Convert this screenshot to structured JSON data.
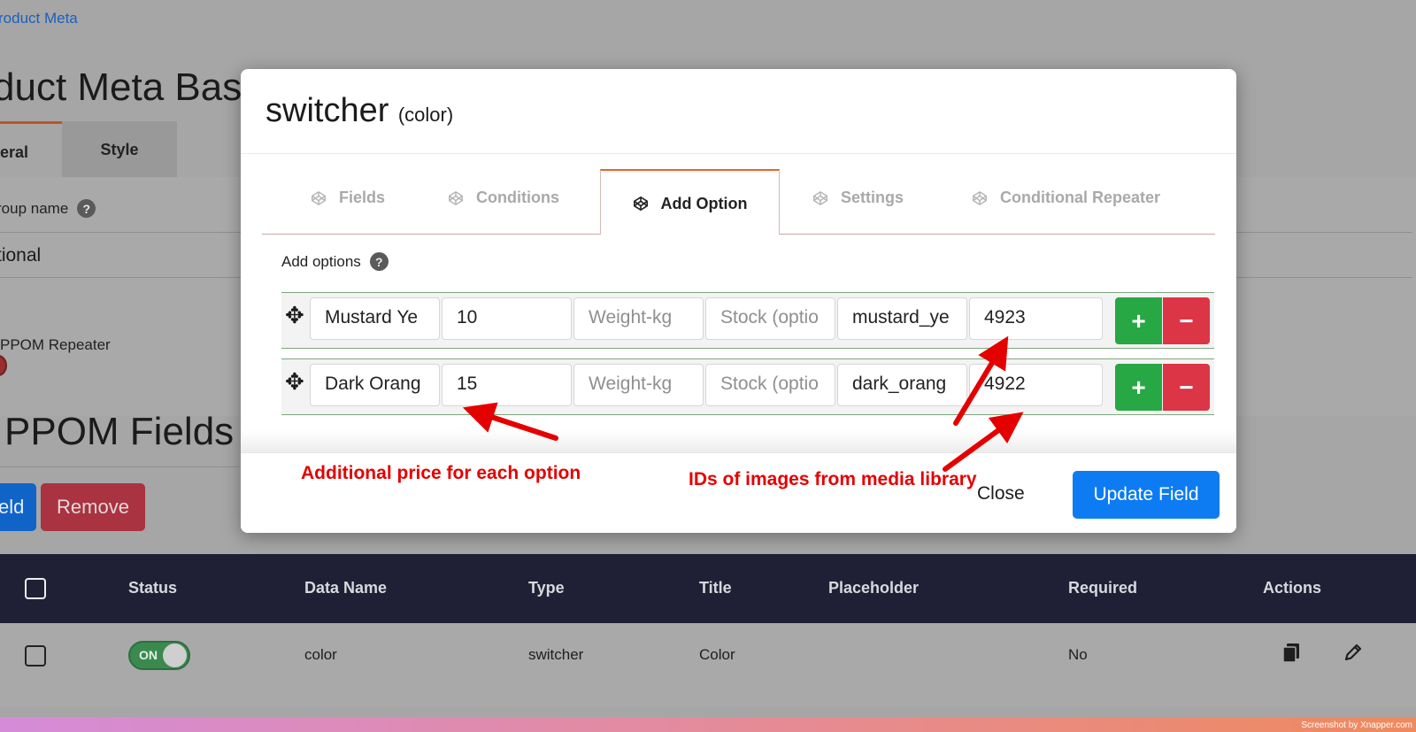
{
  "background": {
    "breadcrumb": "roduct Meta",
    "page_heading": "duct Meta Basi",
    "tabs": {
      "general": "eral",
      "style": "Style"
    },
    "group_name_label": "roup name",
    "group_name_value": "tional",
    "repeater_label": "PPOM Repeater",
    "fields_heading": "PPOM Fields",
    "add_field_button": "eld",
    "remove_button": "Remove"
  },
  "table": {
    "headers": [
      "Status",
      "Data Name",
      "Type",
      "Title",
      "Placeholder",
      "Required",
      "Actions"
    ],
    "row": {
      "status": "ON",
      "data_name": "color",
      "type": "switcher",
      "title": "Color",
      "placeholder": "",
      "required": "No"
    }
  },
  "modal": {
    "title": "switcher",
    "subtitle": "(color)",
    "tabs": [
      {
        "label": "Fields",
        "active": false
      },
      {
        "label": "Conditions",
        "active": false
      },
      {
        "label": "Add Option",
        "active": true
      },
      {
        "label": "Settings",
        "active": false
      },
      {
        "label": "Conditional Repeater",
        "active": false
      }
    ],
    "add_options_label": "Add options",
    "options": [
      {
        "option": "Mustard Ye",
        "price": "10",
        "weight_placeholder": "Weight-kg",
        "stock_placeholder": "Stock (optio",
        "id": "mustard_ye",
        "image_id": "4923"
      },
      {
        "option": "Dark Orang",
        "price": "15",
        "weight_placeholder": "Weight-kg",
        "stock_placeholder": "Stock (optio",
        "id": "dark_orang",
        "image_id": "4922"
      }
    ],
    "plus_label": "+",
    "minus_label": "−",
    "close_button": "Close",
    "update_button": "Update Field"
  },
  "annotations": {
    "price_note": "Additional price for each option",
    "image_note": "IDs of images from media library"
  },
  "colors": {
    "accent_tab": "#e8652a",
    "primary": "#0d7cf2",
    "success": "#28a745",
    "danger": "#dc3545",
    "annotation": "#e50000",
    "table_header": "#1f2035"
  },
  "footer_credit": "Screenshot by Xnapper.com"
}
